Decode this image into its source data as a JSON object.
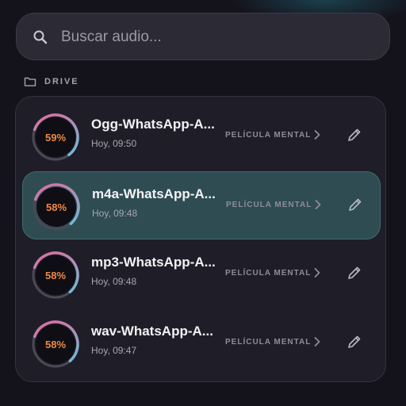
{
  "search": {
    "placeholder": "Buscar audio..."
  },
  "section": {
    "label": "DRIVE",
    "icon": "folder-icon"
  },
  "colors": {
    "background": "#14121b",
    "card": "#1f1e28",
    "active_row": "#2f4c52",
    "percent_text": "#f08a3e",
    "ring_start": "#5fc7df",
    "ring_end": "#e6679b"
  },
  "items": [
    {
      "title": "Ogg-WhatsApp-A...",
      "time": "Hoy, 09:50",
      "tag": "PELÍCULA MENTAL",
      "percent_label": "59%",
      "progress": 0.59,
      "active": false
    },
    {
      "title": "m4a-WhatsApp-A...",
      "time": "Hoy, 09:48",
      "tag": "PELÍCULA MENTAL",
      "percent_label": "58%",
      "progress": 0.58,
      "active": true
    },
    {
      "title": "mp3-WhatsApp-A...",
      "time": "Hoy, 09:48",
      "tag": "PELÍCULA MENTAL",
      "percent_label": "58%",
      "progress": 0.58,
      "active": false
    },
    {
      "title": "wav-WhatsApp-A...",
      "time": "Hoy, 09:47",
      "tag": "PELÍCULA MENTAL",
      "percent_label": "58%",
      "progress": 0.58,
      "active": false
    }
  ]
}
